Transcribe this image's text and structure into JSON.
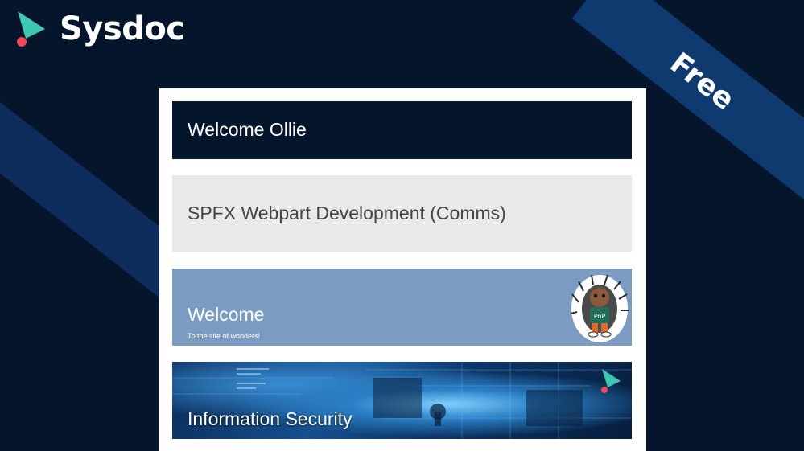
{
  "brand": {
    "name": "Sysdoc",
    "logo_icon": "sysdoc-logo-icon",
    "colors": {
      "teal": "#3ec8b4",
      "red": "#f0485a"
    }
  },
  "ribbon": {
    "label": "Free"
  },
  "cards": {
    "welcome_user": {
      "text": "Welcome Ollie"
    },
    "site_title": {
      "text": "SPFX Webpart Development (Comms)"
    },
    "welcome_banner": {
      "title": "Welcome",
      "subtitle": "To the site of wonders!",
      "mascot_icon": "mascot-image",
      "mascot_badge": "PnP"
    },
    "info_security": {
      "title": "Information Security"
    }
  },
  "colors": {
    "background": "#04152c",
    "stripe": "#0e3a70",
    "banner": "#7b9bc0",
    "site_title_bg": "#e9e9e9"
  }
}
